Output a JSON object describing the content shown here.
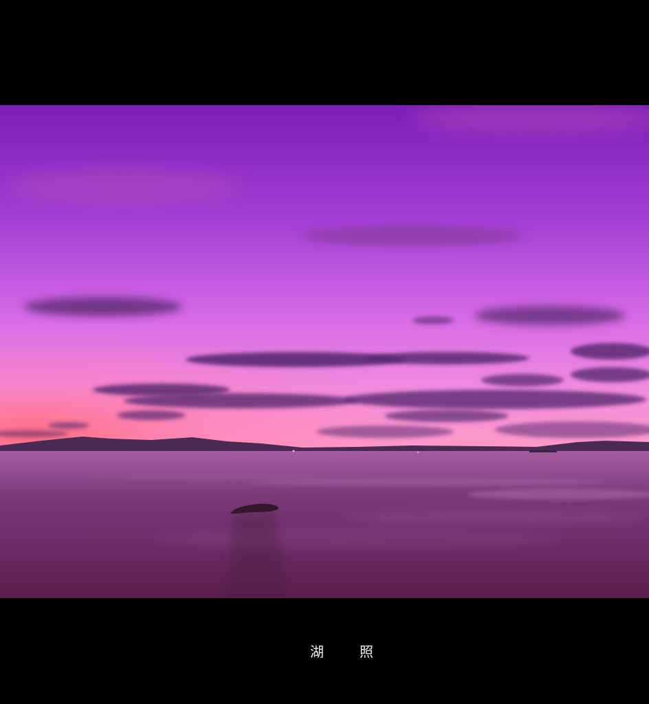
{
  "photo": {
    "subject": "lake-sunset",
    "colors": {
      "sky_top": "#7a1fb8",
      "sky_mid": "#c25ae0",
      "sky_glow": "#f07ad6",
      "horizon": "#ff7a9a",
      "cloud": "#5a2a72",
      "water_top": "#8a4a86",
      "water_bottom": "#5a1e4a",
      "mountain": "#4a2a52"
    }
  },
  "caption": {
    "chars": [
      "湖",
      "照"
    ]
  }
}
